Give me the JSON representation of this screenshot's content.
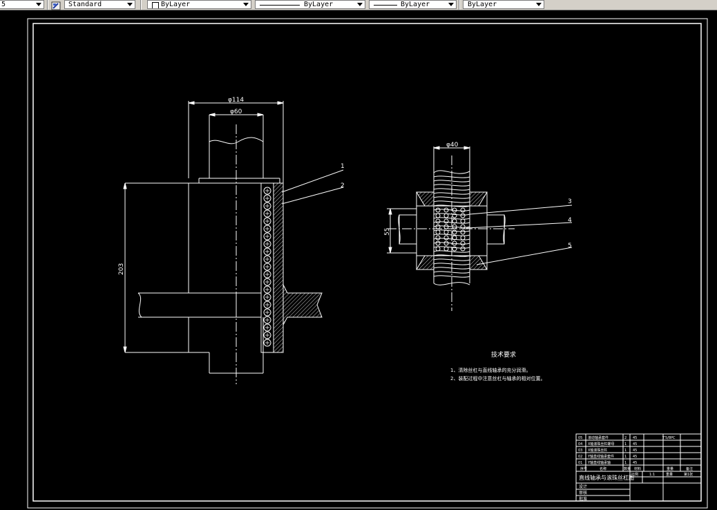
{
  "toolbar": {
    "partial_left_value": "5",
    "text_style": "Standard",
    "color_value": "ByLayer",
    "linetype_value": "ByLayer",
    "lineweight_value": "ByLayer",
    "plotstyle_value": "ByLayer"
  },
  "drawing": {
    "dim_outer_diameter": "φ114",
    "dim_inner_diameter": "φ60",
    "dim_height": "203",
    "dim_screw_diameter": "φ40",
    "dim_nut_height": "55",
    "balloons": [
      "1",
      "2",
      "3",
      "4",
      "5"
    ],
    "tech_title": "技术要求",
    "tech_notes": [
      "1、清除丝杠与直线轴承的充分润滑。",
      "2、装配过程中注意丝杠与轴承的相对位置。"
    ]
  },
  "title_block": {
    "drawing_title": "直线轴承与滚珠丝杠图",
    "parts": [
      {
        "no": "05",
        "name": "滚动轴承套件",
        "qty": "2",
        "material": "45",
        "note": "了5/8PC"
      },
      {
        "no": "04",
        "name": "X轴滚珠丝杠螺母",
        "qty": "1",
        "material": "45",
        "note": ""
      },
      {
        "no": "03",
        "name": "X轴滚珠丝杠",
        "qty": "1",
        "material": "45",
        "note": ""
      },
      {
        "no": "02",
        "name": "Y轴直线轴承套件",
        "qty": "1",
        "material": "45",
        "note": ""
      },
      {
        "no": "01",
        "name": "Y轴直线轴承轴",
        "qty": "1",
        "material": "45",
        "note": ""
      }
    ],
    "header": {
      "no": "序号",
      "name": "名称",
      "qty": "数量",
      "material": "材料",
      "weight": "重量",
      "note": "备注"
    },
    "scale_label": "比例",
    "scale_value": "1:1",
    "weight_label": "重量",
    "sheet_value": "第1张",
    "roles": [
      "设计",
      "审核",
      "批准"
    ]
  }
}
